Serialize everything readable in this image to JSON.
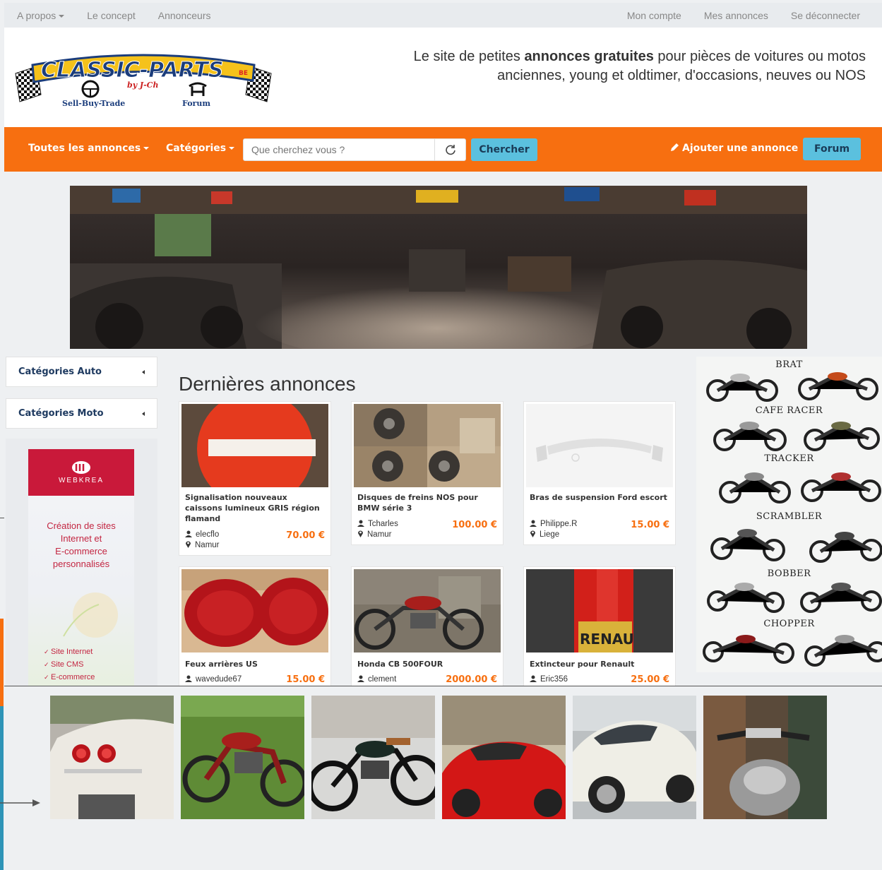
{
  "topbar": {
    "left": [
      {
        "label": "A propos",
        "dropdown": true
      },
      {
        "label": "Le concept"
      },
      {
        "label": "Annonceurs"
      }
    ],
    "right": [
      "Mon compte",
      "Mes annonces",
      "Se déconnecter"
    ]
  },
  "logo": {
    "name": "CLASSIC-PARTS",
    "suffix": "BE",
    "byline": "by J-Ch",
    "left_caption": "Sell-Buy-Trade",
    "right_caption": "Forum"
  },
  "tagline": {
    "before": "Le site de petites ",
    "bold": "annonces gratuites",
    "after": " pour pièces de voitures ou motos anciennes, young et oldtimer, d'occasions, neuves ou NOS"
  },
  "nav": {
    "all_ads": "Toutes les annonces",
    "categories": "Catégories",
    "search_placeholder": "Que cherchez vous ?",
    "search_button": "Chercher",
    "add_ad": "Ajouter une annonce",
    "forum": "Forum"
  },
  "sidebar": {
    "cat_auto": "Catégories Auto",
    "cat_moto": "Catégories Moto",
    "ad": {
      "brand": "WEBKREA",
      "text": [
        "Création de sites",
        "Internet et",
        "E-commerce",
        "personnalisés"
      ],
      "bullets": [
        "Site Internet",
        "Site CMS",
        "E-commerce"
      ]
    }
  },
  "listings": {
    "title": "Dernières annonces",
    "items": [
      {
        "title": "Signalisation nouveaux caissons lumineux GRIS région flamand",
        "user": "elecflo",
        "location": "Namur",
        "price": "70.00 €"
      },
      {
        "title": "Disques de freins NOS pour BMW série 3",
        "user": "Tcharles",
        "location": "Namur",
        "price": "100.00 €"
      },
      {
        "title": "Bras de suspension Ford escort",
        "user": "Philippe.R",
        "location": "Liege",
        "price": "15.00 €"
      },
      {
        "title": "Feux arrières US",
        "user": "wavedude67",
        "location": "",
        "price": "15.00 €"
      },
      {
        "title": "Honda CB 500FOUR",
        "user": "clement",
        "location": "",
        "price": "2000.00 €"
      },
      {
        "title": "Extincteur pour Renault",
        "user": "Eric356",
        "location": "",
        "price": "25.00 €"
      }
    ]
  },
  "bike_styles": [
    "BRAT",
    "CAFE RACER",
    "TRACKER",
    "SCRAMBLER",
    "BOBBER",
    "CHOPPER"
  ],
  "image_texts": {
    "extinguisher_label": "RENAU"
  },
  "colors": {
    "accent": "#f76f10",
    "button": "#5bc0de",
    "price": "#f76f10",
    "nav_text": "#ffffff",
    "ad_red": "#c9193a"
  }
}
